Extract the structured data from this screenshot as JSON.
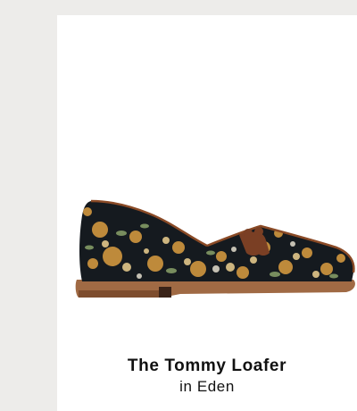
{
  "product": {
    "name": "The Tommy Loafer",
    "variant": "in Eden"
  },
  "colors": {
    "page_background": "#edecea",
    "card_background": "#ffffff",
    "shoe_upper": "#151a1f",
    "floral_gold": "#c8913e",
    "leather_trim": "#8a4a26",
    "sole": "#a06a44",
    "text": "#111111"
  }
}
